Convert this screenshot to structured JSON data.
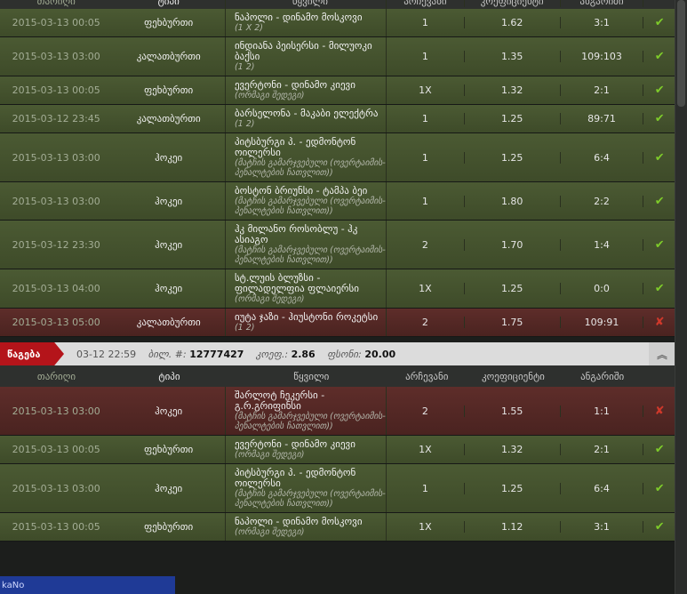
{
  "columns": {
    "date": "თარიღი",
    "type": "ტიპი",
    "match": "წყვილი",
    "pick": "არჩევანი",
    "coef": "კოეფიციენტი",
    "result": "ანგარიში"
  },
  "rows1": [
    {
      "date": "2015-03-13 00:05",
      "type": "ფეხბურთი",
      "title": "ნაპოლი - დინამო მოსკოვი",
      "sub": "(1 X 2)",
      "pick": "1",
      "coef": "1.62",
      "result": "3:1",
      "status": "won"
    },
    {
      "date": "2015-03-13 03:00",
      "type": "კალათბურთი",
      "title": "ინდიანა პეისერსი - მილუოკი ბაქსი",
      "sub": "(1 2)",
      "pick": "1",
      "coef": "1.35",
      "result": "109:103",
      "status": "won"
    },
    {
      "date": "2015-03-13 00:05",
      "type": "ფეხბურთი",
      "title": "ევერტონი - დინამო კიევი",
      "sub": "(ორმაგი შედეგი)",
      "pick": "1X",
      "coef": "1.32",
      "result": "2:1",
      "status": "won"
    },
    {
      "date": "2015-03-12 23:45",
      "type": "კალათბურთი",
      "title": "ბარსელონა - მაკაბი ელექტრა",
      "sub": "(1 2)",
      "pick": "1",
      "coef": "1.25",
      "result": "89:71",
      "status": "won"
    },
    {
      "date": "2015-03-13 03:00",
      "type": "ჰოკეი",
      "title": "პიტსბურგი პ. - ედმონტონ ოილერსი",
      "sub": "(მატჩის გამარჯვებული (ოვერტაიმის-პენალტების ჩათვლით))",
      "pick": "1",
      "coef": "1.25",
      "result": "6:4",
      "status": "won"
    },
    {
      "date": "2015-03-13 03:00",
      "type": "ჰოკეი",
      "title": "ბოსტონ ბრიუნსი - ტამპა ბეი",
      "sub": "(მატჩის გამარჯვებული (ოვერტაიმის-პენალტების ჩათვლით))",
      "pick": "1",
      "coef": "1.80",
      "result": "2:2",
      "status": "won"
    },
    {
      "date": "2015-03-12 23:30",
      "type": "ჰოკეი",
      "title": "ჰკ მილანო როსობლუ - ჰკ ასიაგო",
      "sub": "(მატჩის გამარჯვებული (ოვერტაიმის-პენალტების ჩათვლით))",
      "pick": "2",
      "coef": "1.70",
      "result": "1:4",
      "status": "won"
    },
    {
      "date": "2015-03-13 04:00",
      "type": "ჰოკეი",
      "title": "სტ.ლუის ბლუზსი - ფილადელფია ფლაიერსი",
      "sub": "(ორმაგი შედეგი)",
      "pick": "1X",
      "coef": "1.25",
      "result": "0:0",
      "status": "won"
    },
    {
      "date": "2015-03-13 05:00",
      "type": "კალათბურთი",
      "title": "იუტა ჯაზი - ჰიუსტონი როკეტსი",
      "sub": "(1 2)",
      "pick": "2",
      "coef": "1.75",
      "result": "109:91",
      "status": "lost"
    }
  ],
  "slip": {
    "status": "წაგება",
    "datetime": "03-12 22:59",
    "id_label": "ბილ. #:",
    "id": "12777427",
    "coef_label": "კოეფ.:",
    "coef": "2.86",
    "amount_label": "ფსონი:",
    "amount": "20.00"
  },
  "rows2": [
    {
      "date": "2015-03-13 03:00",
      "type": "ჰოკეი",
      "title": "შარლოტ ჩეკერსი - გ.რ.გრიფინსი",
      "sub": "(მატჩის გამარჯვებული (ოვერტაიმის-პენალტების ჩათვლით))",
      "pick": "2",
      "coef": "1.55",
      "result": "1:1",
      "status": "lost"
    },
    {
      "date": "2015-03-13 00:05",
      "type": "ფეხბურთი",
      "title": "ევერტონი - დინამო კიევი",
      "sub": "(ორმაგი შედეგი)",
      "pick": "1X",
      "coef": "1.32",
      "result": "2:1",
      "status": "won"
    },
    {
      "date": "2015-03-13 03:00",
      "type": "ჰოკეი",
      "title": "პიტსბურგი პ. - ედმონტონ ოილერსი",
      "sub": "(მატჩის გამარჯვებული (ოვერტაიმის-პენალტების ჩათვლით))",
      "pick": "1",
      "coef": "1.25",
      "result": "6:4",
      "status": "won"
    },
    {
      "date": "2015-03-13 00:05",
      "type": "ფეხბურთი",
      "title": "ნაპოლი - დინამო მოსკოვი",
      "sub": "(ორმაგი შედეგი)",
      "pick": "1X",
      "coef": "1.12",
      "result": "3:1",
      "status": "won"
    }
  ],
  "icons": {
    "won": "check-icon",
    "lost": "cross-icon",
    "collapse": "chevron-double-up-icon"
  },
  "colors": {
    "won": "#7ecb2a",
    "lost": "#d0392b",
    "ribbon": "#b4141a"
  },
  "taskbar": {
    "label": "kaNo"
  }
}
